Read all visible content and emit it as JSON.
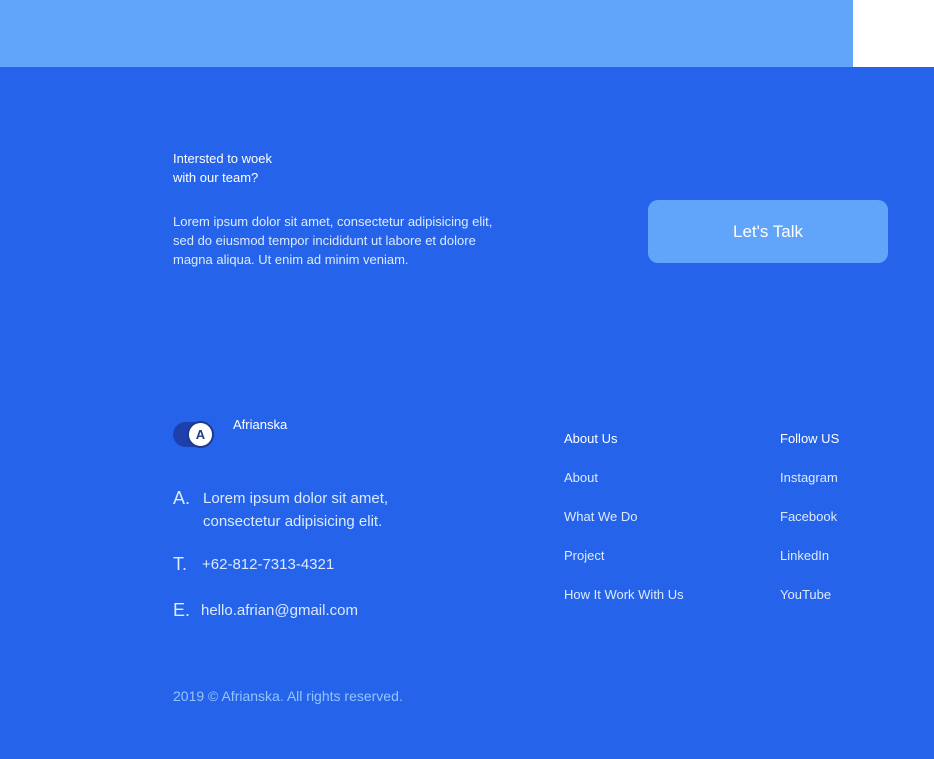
{
  "cta": {
    "heading_line1": "Intersted to woek",
    "heading_line2": "with our team?",
    "text_line1": "Lorem ipsum dolor sit amet, consectetur adipisicing elit,",
    "text_line2": "sed do eiusmod tempor incididunt ut labore et dolore",
    "text_line3": "magna aliqua. Ut enim ad minim veniam.",
    "button_label": "Let's Talk"
  },
  "brand": {
    "logo_letter": "A",
    "name": "Afrianska"
  },
  "contact": {
    "address_label": "A.",
    "address_line1": "Lorem ipsum dolor sit amet,",
    "address_line2": "consectetur adipisicing elit.",
    "phone_label": "T.",
    "phone": "+62-812-7313-4321",
    "email_label": "E.",
    "email": "hello.afrian@gmail.com"
  },
  "columns": [
    {
      "title": "About Us",
      "links": [
        "About",
        "What We Do",
        "Project",
        "How It Work With Us"
      ]
    },
    {
      "title": "Follow US",
      "links": [
        "Instagram",
        "Facebook",
        "LinkedIn",
        "YouTube"
      ]
    }
  ],
  "copyright": "2019 © Afrianska. All rights reserved.",
  "colors": {
    "footer_bg": "#2563EB",
    "accent_light": "#60A5FA"
  }
}
